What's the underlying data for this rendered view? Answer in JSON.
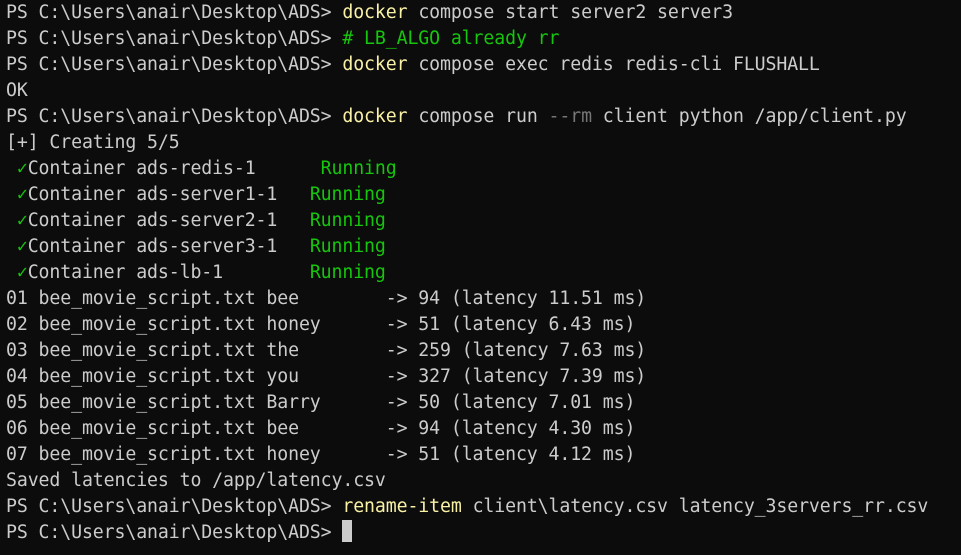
{
  "colors": {
    "background": "#0c0c0c",
    "foreground": "#cccccc",
    "command": "#f9f1a5",
    "success": "#16c60c",
    "flag": "#767676"
  },
  "prompt": "PS C:\\Users\\anair\\Desktop\\ADS> ",
  "lines": [
    {
      "type": "cmd",
      "cmd": "docker",
      "args": " compose start server2 server3"
    },
    {
      "type": "comment",
      "text": "# LB_ALGO already rr"
    },
    {
      "type": "cmd",
      "cmd": "docker",
      "args": " compose exec redis redis-cli FLUSHALL"
    },
    {
      "type": "output",
      "text": "OK"
    },
    {
      "type": "cmd_flag",
      "cmd": "docker",
      "args_before": " compose run ",
      "flag": "--rm",
      "args_after": " client python /app/client.py"
    },
    {
      "type": "output",
      "text": "[+] Creating 5/5"
    },
    {
      "type": "container",
      "name": "Container ads-redis-1      ",
      "status": "Running"
    },
    {
      "type": "container",
      "name": "Container ads-server1-1   ",
      "status": "Running"
    },
    {
      "type": "container",
      "name": "Container ads-server2-1   ",
      "status": "Running"
    },
    {
      "type": "container",
      "name": "Container ads-server3-1   ",
      "status": "Running"
    },
    {
      "type": "container",
      "name": "Container ads-lb-1        ",
      "status": "Running"
    },
    {
      "type": "output",
      "text": "01 bee_movie_script.txt bee        -> 94 (latency 11.51 ms)"
    },
    {
      "type": "output",
      "text": "02 bee_movie_script.txt honey      -> 51 (latency 6.43 ms)"
    },
    {
      "type": "output",
      "text": "03 bee_movie_script.txt the        -> 259 (latency 7.63 ms)"
    },
    {
      "type": "output",
      "text": "04 bee_movie_script.txt you        -> 327 (latency 7.39 ms)"
    },
    {
      "type": "output",
      "text": "05 bee_movie_script.txt Barry      -> 50 (latency 7.01 ms)"
    },
    {
      "type": "output",
      "text": "06 bee_movie_script.txt bee        -> 94 (latency 4.30 ms)"
    },
    {
      "type": "output",
      "text": "07 bee_movie_script.txt honey      -> 51 (latency 4.12 ms)"
    },
    {
      "type": "output",
      "text": "Saved latencies to /app/latency.csv"
    },
    {
      "type": "cmd",
      "cmd": "rename-item",
      "args": " client\\latency.csv latency_3servers_rr.csv"
    },
    {
      "type": "input_prompt"
    }
  ],
  "check_glyph": " ✓"
}
